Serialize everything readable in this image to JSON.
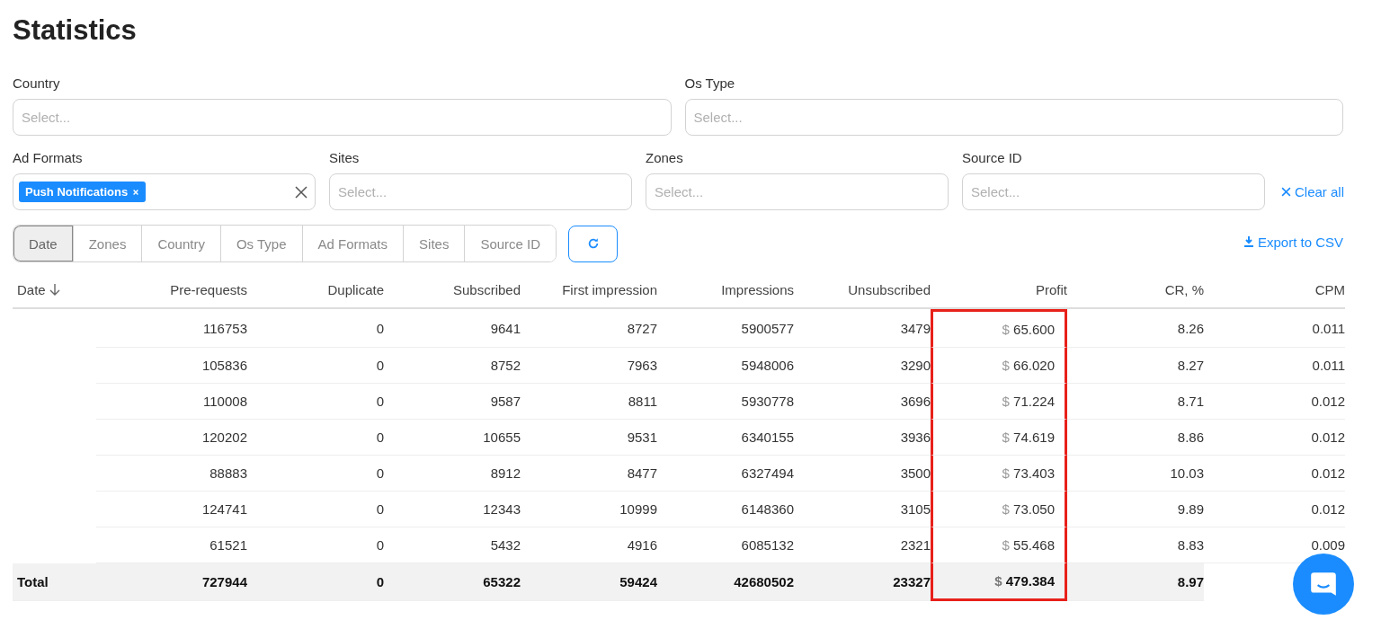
{
  "title": "Statistics",
  "filters_top": [
    {
      "label": "Country",
      "placeholder": "Select..."
    },
    {
      "label": "Os Type",
      "placeholder": "Select..."
    }
  ],
  "filters_bottom": [
    {
      "label": "Ad Formats",
      "tags": [
        "Push Notifications"
      ]
    },
    {
      "label": "Sites",
      "placeholder": "Select..."
    },
    {
      "label": "Zones",
      "placeholder": "Select..."
    },
    {
      "label": "Source ID",
      "placeholder": "Select..."
    }
  ],
  "clear_all": "Clear all",
  "group_by": [
    {
      "label": "Date",
      "selected": true
    },
    {
      "label": "Zones",
      "selected": false
    },
    {
      "label": "Country",
      "selected": false
    },
    {
      "label": "Os Type",
      "selected": false
    },
    {
      "label": "Ad Formats",
      "selected": false
    },
    {
      "label": "Sites",
      "selected": false
    },
    {
      "label": "Source ID",
      "selected": false
    }
  ],
  "export": "Export to CSV",
  "table": {
    "columns": [
      {
        "label": "Date",
        "sorted": true,
        "highlighted": false
      },
      {
        "label": "Pre-requests",
        "sorted": false,
        "highlighted": false
      },
      {
        "label": "Duplicate",
        "sorted": false,
        "highlighted": false
      },
      {
        "label": "Subscribed",
        "sorted": false,
        "highlighted": false
      },
      {
        "label": "First impression",
        "sorted": false,
        "highlighted": false
      },
      {
        "label": "Impressions",
        "sorted": false,
        "highlighted": false
      },
      {
        "label": "Unsubscribed",
        "sorted": false,
        "highlighted": false
      },
      {
        "label": "Profit",
        "sorted": false,
        "highlighted": true
      },
      {
        "label": "CR, %",
        "sorted": false,
        "highlighted": false
      },
      {
        "label": "CPM",
        "sorted": false,
        "highlighted": false
      }
    ],
    "currency": "$",
    "rows": [
      [
        "",
        "116753",
        "0",
        "9641",
        "8727",
        "5900577",
        "3479",
        "65.600",
        "8.26",
        "0.011"
      ],
      [
        "",
        "105836",
        "0",
        "8752",
        "7963",
        "5948006",
        "3290",
        "66.020",
        "8.27",
        "0.011"
      ],
      [
        "",
        "110008",
        "0",
        "9587",
        "8811",
        "5930778",
        "3696",
        "71.224",
        "8.71",
        "0.012"
      ],
      [
        "",
        "120202",
        "0",
        "10655",
        "9531",
        "6340155",
        "3936",
        "74.619",
        "8.86",
        "0.012"
      ],
      [
        "",
        "88883",
        "0",
        "8912",
        "8477",
        "6327494",
        "3500",
        "73.403",
        "10.03",
        "0.012"
      ],
      [
        "",
        "124741",
        "0",
        "12343",
        "10999",
        "6148360",
        "3105",
        "73.050",
        "9.89",
        "0.012"
      ],
      [
        "",
        "61521",
        "0",
        "5432",
        "4916",
        "6085132",
        "2321",
        "55.468",
        "8.83",
        "0.009"
      ]
    ],
    "total": [
      "Total",
      "727944",
      "0",
      "65322",
      "59424",
      "42680502",
      "23327",
      "479.384",
      "8.97"
    ]
  }
}
